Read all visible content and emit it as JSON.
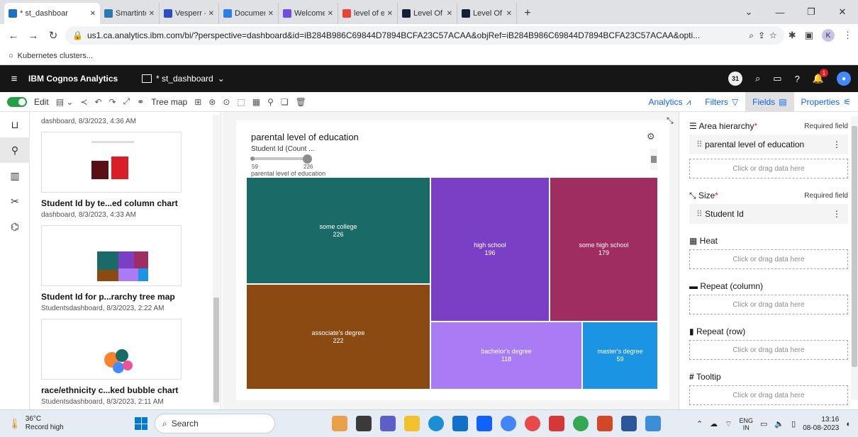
{
  "browser": {
    "tabs": [
      {
        "title": "* st_dashboar",
        "active": true,
        "color": "#1f70c1"
      },
      {
        "title": "Smartinternz",
        "color": "#2a7ab0"
      },
      {
        "title": "Vesperr - Cre",
        "color": "#2b4ec7"
      },
      {
        "title": "Documentati",
        "color": "#2b7de9"
      },
      {
        "title": "Welcome",
        "color": "#6e4fe0"
      },
      {
        "title": "level of educa",
        "color": "#ea4335"
      },
      {
        "title": "Level Of Educ",
        "color": "#162032"
      },
      {
        "title": "Level Of Educ",
        "color": "#162032"
      }
    ],
    "url": "us1.ca.analytics.ibm.com/bi/?perspective=dashboard&id=iB284B986C69844D7894BCFA23C57ACAA&objRef=iB284B986C69844D7894BCFA23C57ACAA&opti...",
    "profile_initial": "K",
    "bookmark": "Kubernetes clusters..."
  },
  "app": {
    "brand": "IBM Cognos Analytics",
    "dashboard_name": "* st_dashboard",
    "assistant_badge": "31",
    "notification_count": "1"
  },
  "toolbar": {
    "edit_label": "Edit",
    "tree_map_label": "Tree map",
    "analytics_label": "Analytics",
    "filters_label": "Filters",
    "fields_label": "Fields",
    "properties_label": "Properties"
  },
  "panel": {
    "top_meta": "dashboard, 8/3/2023, 4:36 AM",
    "items": [
      {
        "title": "Student Id by te...ed column chart",
        "meta": "dashboard, 8/3/2023, 4:33 AM"
      },
      {
        "title": "Student Id for p...rarchy tree map",
        "meta": "Studentsdashboard, 8/3/2023, 2:22 AM"
      },
      {
        "title": "race/ethnicity c...ked bubble chart",
        "meta": "Studentsdashboard, 8/3/2023, 2:11 AM"
      }
    ]
  },
  "widget": {
    "title": "parental level of education",
    "slider_label": "Student Id (Count ...",
    "slider_min": "59",
    "slider_max": "226",
    "legend_caption": "parental level of education"
  },
  "chart_data": {
    "type": "treemap",
    "title": "parental level of education",
    "size_measure": "Student Id",
    "items": [
      {
        "label": "some college",
        "value": 226,
        "color": "#1a6b67"
      },
      {
        "label": "associate's degree",
        "value": 222,
        "color": "#8a4a12"
      },
      {
        "label": "high school",
        "value": 196,
        "color": "#7a3fc4"
      },
      {
        "label": "some high school",
        "value": 179,
        "color": "#a02d61"
      },
      {
        "label": "bachelor's degree",
        "value": 118,
        "color": "#a97cf5"
      },
      {
        "label": "master's degree",
        "value": 59,
        "color": "#1a94e3"
      }
    ]
  },
  "properties": {
    "area_hierarchy_label": "Area hierarchy",
    "required_text": "Required field",
    "area_field": "parental level of education",
    "drop_text": "Click or drag data here",
    "size_label": "Size",
    "size_field": "Student Id",
    "heat_label": "Heat",
    "repeat_col_label": "Repeat (column)",
    "repeat_row_label": "Repeat (row)",
    "tooltip_label": "Tooltip"
  },
  "taskbar": {
    "temp": "36°C",
    "weather_text": "Record high",
    "search_placeholder": "Search",
    "lang_top": "ENG",
    "lang_bottom": "IN",
    "time": "13:16",
    "date": "08-08-2023"
  }
}
